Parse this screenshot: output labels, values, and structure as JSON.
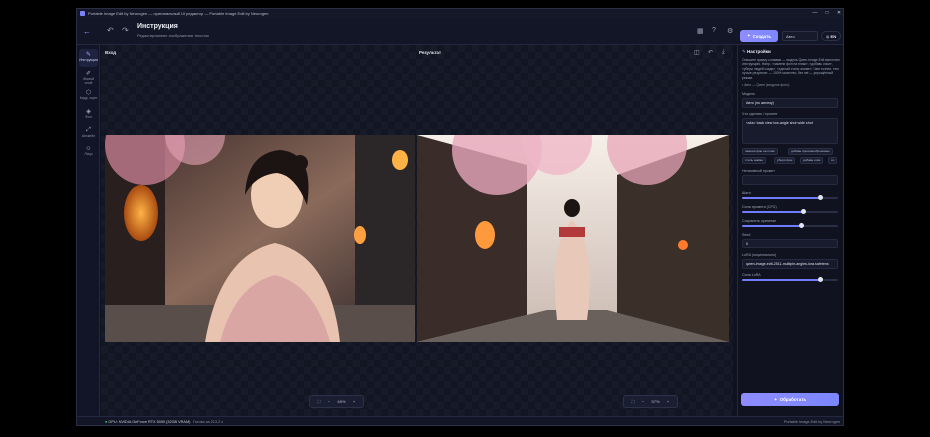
{
  "window": {
    "title": "Portable Image Edit by Neurogen — оригинальный UI редактор — Portable Image Edit by Neurogen",
    "controls": [
      "—",
      "□",
      "✕"
    ]
  },
  "header": {
    "title": "Инструкция",
    "subtitle": "Редактирование изображения текстом",
    "primary_button": "Создать",
    "select_value": "Авто",
    "language": "EN"
  },
  "rail": {
    "items": [
      {
        "label": "Инструкция",
        "icon": "✎",
        "active": true
      },
      {
        "label": "Живой слой",
        "icon": "✐",
        "active": false
      },
      {
        "label": "Кадр. сцен",
        "icon": "⬡",
        "active": false
      },
      {
        "label": "Фон",
        "icon": "◈",
        "active": false
      },
      {
        "label": "Апскейл",
        "icon": "⤢",
        "active": false
      },
      {
        "label": "Лицо",
        "icon": "☺",
        "active": false
      }
    ]
  },
  "canvas": {
    "left_label": "Вход",
    "right_label": "Результат",
    "left_zoom": "69%",
    "right_zoom": "57%"
  },
  "panel": {
    "title": "Настройки",
    "description": "Опишите правку словами — модель Qwen-Image-Edit выполнит инструкцию. Напр.: «замени фон на пляж», «добавь очки», «убери людей сзади», «сделай стиль аниме». Чем точнее, тем лучше результат. — 100% качество; без net — упрощённый режим.",
    "note": "• Авто — Qwen (входное фото)",
    "model_label": "Модель",
    "model_value": "Авто (по железу)",
    "prompt_label": "Что сделать / промпт",
    "prompt_value": "<sks> back view low-angle shot wide shot",
    "chips": [
      "замени фон на пляж",
      "добавь прохожих/фоновые",
      "стиль аниме",
      "убери фон",
      "добавь очки",
      "со"
    ],
    "negative_label": "Негативный промпт",
    "steps_label": "Шаги",
    "cfg_label": "Сила промпта (CFG)",
    "strength_label": "Сохранить оригинал",
    "seed_label": "Seed",
    "seed_value": "0",
    "lora_label": "LoRA (опционально)",
    "lora_value": "qwen-image-edit-2511-multiple-angles-lora.safetens",
    "lora_strength_label": "Сила LoRA",
    "sliders": {
      "steps": 0.82,
      "cfg": 0.64,
      "strength": 0.62,
      "lora": 0.82
    },
    "run_button": "Обработать"
  },
  "status": {
    "gpu": "GPU: NVIDIA GeForce RTX 5090 (32GB VRAM)",
    "ready": "Готово за 213.2 с",
    "right": "Portable Image Edit by Neurogen"
  },
  "colors": {
    "accent": "#7f88ff",
    "bg": "#0f1220",
    "panel": "#10131f"
  }
}
